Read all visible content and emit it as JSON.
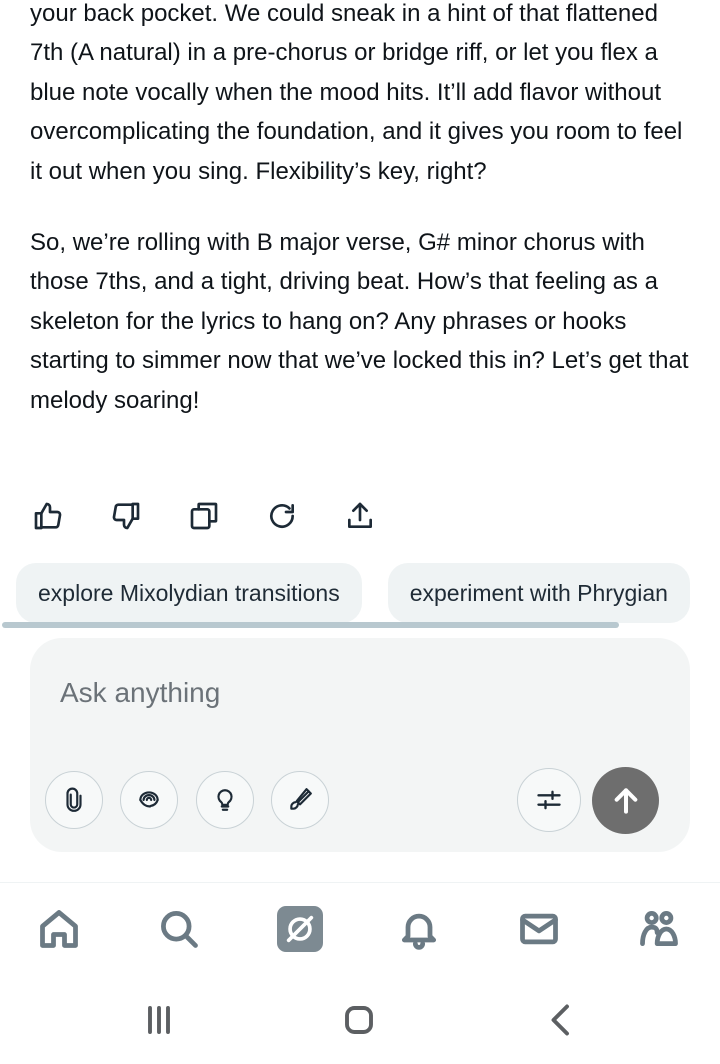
{
  "message": {
    "paragraphs": [
      "your back pocket. We could sneak in a hint of that flattened 7th (A natural) in a pre-chorus or bridge riff, or let you flex a blue note vocally when the mood hits. It’ll add flavor without overcomplicating the foundation, and it gives you room to feel it out when you sing. Flexibility’s key, right?",
      "So, we’re rolling with B major verse, G# minor chorus with those 7ths, and a tight, driving beat. How’s that feeling as a skeleton for the lyrics to hang on? Any phrases or hooks starting to simmer now that we’ve locked this in? Let’s get that melody soaring!"
    ]
  },
  "actions": {
    "icons": [
      "thumbs-up-icon",
      "thumbs-down-icon",
      "copy-icon",
      "regenerate-icon",
      "share-icon"
    ]
  },
  "suggestions": [
    "explore Mixolydian transitions",
    "experiment with Phrygian"
  ],
  "composer": {
    "placeholder": "Ask anything",
    "tools": [
      "attach-icon",
      "deepsearch-icon",
      "think-icon",
      "draw-icon"
    ],
    "tune_icon": "settings-sliders-icon",
    "send_icon": "arrow-up-icon",
    "send_color": "#6e6e6e"
  },
  "tabbar": {
    "items": [
      "home",
      "search",
      "grok",
      "notifications",
      "messages",
      "communities"
    ],
    "active": "grok",
    "active_color": "#7d8a92"
  },
  "system_nav": [
    "recents",
    "home",
    "back"
  ]
}
